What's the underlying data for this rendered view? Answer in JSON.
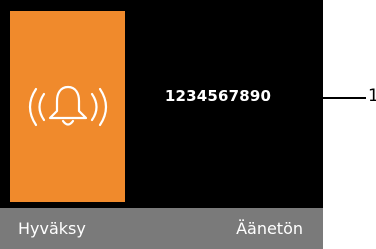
{
  "incoming_call": {
    "caller_number": "1234567890",
    "panel_color": "#f08a2c",
    "icon": "ringing-bell-icon"
  },
  "softkeys": {
    "left_label": "Hyväksy",
    "right_label": "Äänetön"
  },
  "callout": {
    "label": "1"
  }
}
